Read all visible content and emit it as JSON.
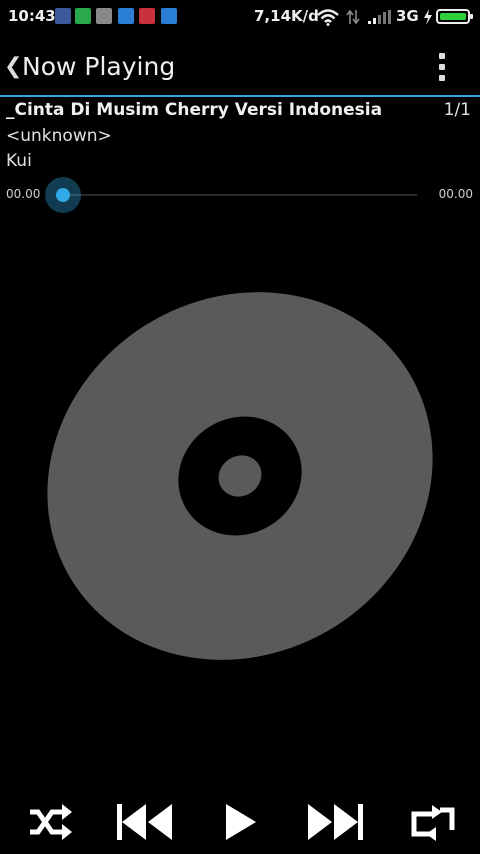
{
  "status_bar": {
    "time": "10:43",
    "speed": "7,14K/d",
    "network": "3G",
    "notifications": [
      "facebook-icon",
      "bbm-icon",
      "app-icon",
      "camera-icon",
      "message-icon",
      "weather-icon"
    ],
    "battery_color": "#2fd13a"
  },
  "header": {
    "title": "Now Playing"
  },
  "track": {
    "title": "_Cinta Di Musim Cherry Versi Indonesia",
    "artist": "<unknown>",
    "album": "Kui",
    "position": "1/1"
  },
  "seek": {
    "elapsed": "00.00",
    "total": "00.00",
    "progress": 0
  },
  "controls": [
    "shuffle",
    "previous",
    "play",
    "next",
    "repeat"
  ],
  "accent_color": "#32a8e6"
}
